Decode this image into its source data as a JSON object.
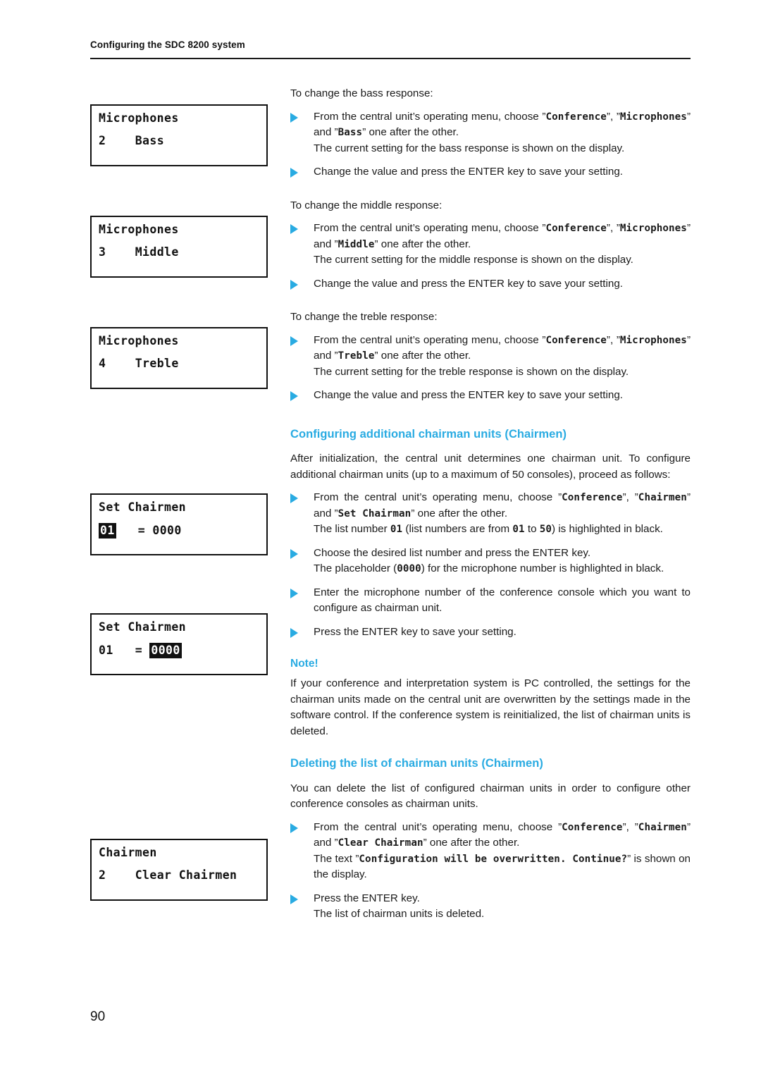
{
  "header": {
    "running_head": "Configuring the SDC 8200 system"
  },
  "folio": {
    "page_number": "90"
  },
  "colors": {
    "accent_cyan": "#29ABE2",
    "text_black": "#1a1a1a",
    "lcd_border": "#111111"
  },
  "lcd_displays": [
    {
      "name": "microphones-bass",
      "line1": "Microphones",
      "line2_index": "2",
      "line2_label": "Bass",
      "highlight": "none"
    },
    {
      "name": "microphones-middle",
      "line1": "Microphones",
      "line2_index": "3",
      "line2_label": "Middle",
      "highlight": "none"
    },
    {
      "name": "microphones-treble",
      "line1": "Microphones",
      "line2_index": "4",
      "line2_label": "Treble",
      "highlight": "none"
    },
    {
      "name": "set-chairmen-listnumber",
      "line1": "Set Chairmen",
      "list_number": "01",
      "equals": "=",
      "mic_number": "0000",
      "highlight": "list_number"
    },
    {
      "name": "set-chairmen-micnumber",
      "line1": "Set Chairmen",
      "list_number": "01",
      "equals": "=",
      "mic_number": "0000",
      "highlight": "mic_number"
    },
    {
      "name": "chairmen-clear",
      "line1": "Chairmen",
      "line2_index": "2",
      "line2_label": "Clear Chairmen",
      "highlight": "none"
    }
  ],
  "sections": {
    "bass": {
      "intro": "To change the bass response:",
      "b1_part1": "From the central unit’s operating menu, choose ”",
      "b1_mono1": "Conference",
      "b1_part2": "”, ”",
      "b1_mono2": "Microphones",
      "b1_part3": "” and ”",
      "b1_mono3": "Bass",
      "b1_part4": "” one after the other.",
      "b1_line3": "The current setting for the bass response is shown on the display.",
      "b2": "Change the value and press the ENTER key to save your setting."
    },
    "middle": {
      "intro": "To change the middle response:",
      "b1_part1": "From the central unit’s operating menu, choose ”",
      "b1_mono1": "Conference",
      "b1_part2": "”, ”",
      "b1_mono2": "Microphones",
      "b1_part3": "” and ”",
      "b1_mono3": "Middle",
      "b1_part4": "” one after the other.",
      "b1_line3": "The current setting for the middle response is shown on the display.",
      "b2": "Change the value and press the ENTER key to save your setting."
    },
    "treble": {
      "intro": "To change the treble response:",
      "b1_part1": "From the central unit’s operating menu, choose ”",
      "b1_mono1": "Conference",
      "b1_part2": "”, ”",
      "b1_mono2": "Microphones",
      "b1_part3": "” and ”",
      "b1_mono3": "Treble",
      "b1_part4": "” one after the other.",
      "b1_line3": "The current setting for the treble response is shown on the display.",
      "b2": "Change the value and press the ENTER key to save your setting."
    },
    "configuring_chairmen": {
      "heading": "Configuring additional chairman units (Chairmen)",
      "para": "After initialization, the central unit determines one chairman unit. To configure additional chairman units (up to a maximum of 50 consoles), proceed as follows:",
      "b1_part1": "From the central unit’s operating menu, choose ”",
      "b1_mono1": "Conference",
      "b1_part2": "”, ”",
      "b1_mono2": "Chairmen",
      "b1_part3": "” and ”",
      "b1_mono3": "Set Chairman",
      "b1_part4": "” one after the other.",
      "b1_line3_a": "The list number ",
      "b1_line3_m1": "01",
      "b1_line3_b": " (list numbers are from ",
      "b1_line3_m2": "01",
      "b1_line3_c": " to ",
      "b1_line3_m3": "50",
      "b1_line3_d": ") is highlighted in black.",
      "b2_line1": "Choose the desired list number and press the ENTER key.",
      "b2_line2_a": "The placeholder (",
      "b2_line2_m": "0000",
      "b2_line2_b": ") for the microphone number is highlighted in black.",
      "b3": "Enter the microphone number of the conference console which you want to configure as chairman unit.",
      "b4": "Press the ENTER key to save your setting."
    },
    "note": {
      "label": "Note!",
      "text": "If your conference and interpretation system is PC controlled, the settings for the chairman units made on the central unit are overwritten by the settings made in the software control. If the conference system is reinitialized, the list of chairman units is deleted."
    },
    "deleting_chairmen": {
      "heading": "Deleting the list of chairman units (Chairmen)",
      "para": "You can delete the list of configured chairman units in order to configure other conference consoles as chairman units.",
      "b1_part1": "From the central unit’s operating menu, choose ”",
      "b1_mono1": "Conference",
      "b1_part2": "”, ”",
      "b1_mono2": "Chairmen",
      "b1_part3": "” and ”",
      "b1_mono3": "Clear Chairman",
      "b1_part4": "” one after the other.",
      "b1_line3_a": "The text ”",
      "b1_line3_m": "Configuration will be overwritten. Continue?",
      "b1_line3_b": "” is shown on the display.",
      "b2_line1": "Press the ENTER key.",
      "b2_line2": "The list of chairman units is deleted."
    }
  }
}
